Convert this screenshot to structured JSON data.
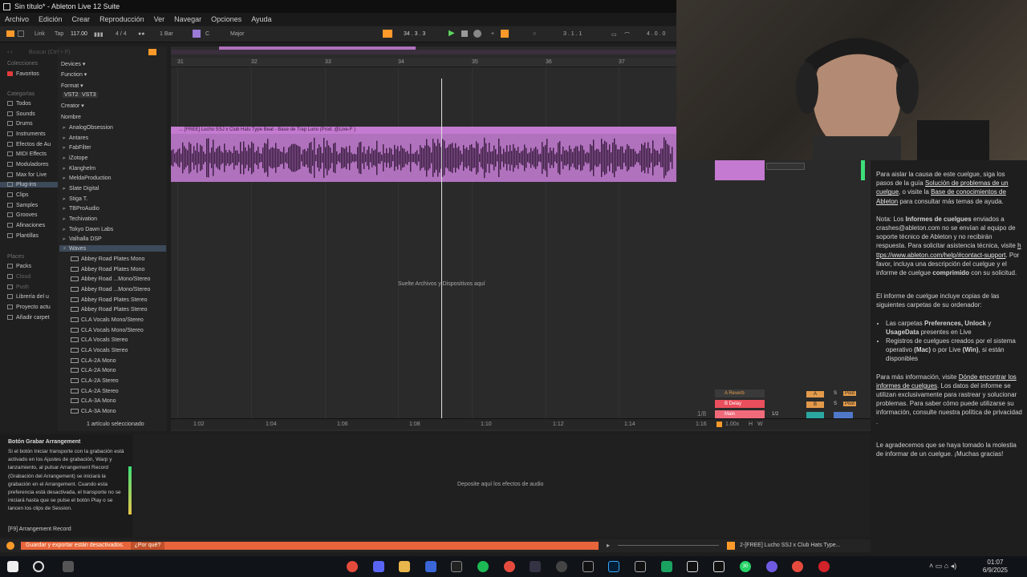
{
  "window": {
    "title": "Sin título* - Ableton Live 12 Suite"
  },
  "menu": [
    "Archivo",
    "Edición",
    "Crear",
    "Reproducción",
    "Ver",
    "Navegar",
    "Opciones",
    "Ayuda"
  ],
  "toolbar": {
    "link": "Link",
    "tap": "Tap",
    "tempo": "117.00",
    "signature": "4 / 4",
    "quantize": "1 Bar",
    "key": "C",
    "scale": "Major",
    "position": "34 .   3 .   3",
    "loop_start": "3 .   1 .   1",
    "loop_len": "4 .   0 .   0"
  },
  "browser": {
    "search_placeholder": "Buscar (Ctrl + F)",
    "collections_head": "Colecciones",
    "favorites": "Favoritos",
    "categories_head": "Categorías",
    "categories": [
      "Todos",
      "Sounds",
      "Drums",
      "Instruments",
      "Efectos de Au",
      "MIDI Effects",
      "Moduladores",
      "Max for Live",
      "Plug-ins",
      "Clips",
      "Samples",
      "Grooves",
      "Afinaciones",
      "Plantillas"
    ],
    "places_head": "Places",
    "places": [
      "Packs",
      "Cloud",
      "Push",
      "Librería del u",
      "Proyecto actu",
      "Añadir carpet"
    ],
    "filters": [
      "Devices ▾",
      "Function ▾",
      "Format ▾",
      "Creator ▾"
    ],
    "formats": [
      "VST2",
      "VST3"
    ],
    "column": "Nombre",
    "vendors": [
      "AnalogObsession",
      "Antares",
      "FabFilter",
      "iZotope",
      "Klanghelm",
      "MeldaProduction",
      "Slate Digital",
      "Stiga T.",
      "TBProAudio",
      "Techivation",
      "Tokyo Dawn Labs",
      "Valhalla DSP",
      "Waves"
    ],
    "plugins": [
      "Abbey Road Plates Mono",
      "Abbey Road Plates Mono",
      "Abbey Road ...Mono/Stereo",
      "Abbey Road ...Mono/Stereo",
      "Abbey Road Plates Stereo",
      "Abbey Road Plates Stereo",
      "CLA Vocals Mono/Stereo",
      "CLA Vocals Mono/Stereo",
      "CLA Vocals Stereo",
      "CLA Vocals Stereo",
      "CLA-2A Mono",
      "CLA-2A Mono",
      "CLA-2A Stereo",
      "CLA-2A Stereo",
      "CLA-3A Mono",
      "CLA-3A Mono"
    ],
    "status": "1 artículo seleccionado"
  },
  "arrangement": {
    "bars": [
      "31",
      "32",
      "33",
      "34",
      "35",
      "36",
      "37"
    ],
    "clip_name": "... [FREE] Lucho SSJ x Club Hats Type Beat - Base de Trap Luno (Prod. @Live-F )",
    "drop_hint": "Suelte Archivos y Dispositivos aquí",
    "times": [
      "1:02",
      "1:04",
      "1:06",
      "1:08",
      "1:10",
      "1:12",
      "1:14",
      "1:16"
    ],
    "tracks": [
      {
        "name": "A Reverb",
        "letter": "A",
        "color": "#e39a4a"
      },
      {
        "name": "B Delay",
        "letter": "B",
        "color": "#e94f5c"
      },
      {
        "name": "Main",
        "letter": "",
        "color": "#f06a7a"
      }
    ],
    "fraction": "1/8",
    "main_div": "1/2",
    "zoom": "1.00x",
    "h_label": "H",
    "w_label": "W",
    "post": "Post",
    "s": "S"
  },
  "info": {
    "title": "Botón Grabar Arrangement",
    "body": "Si el botón Iniciar transporte con la grabación está activado en los Ajustes de grabación, Warp y lanzamiento, al pulsar Arrangement Record (Grabación del Arrangement) se iniciará la grabación en el Arrangement. Cuando esta preferencia está desactivada, el transporte no se iniciará hasta que se pulse el botón Play o se lancen los clips de Session.",
    "shortcut": "[F9] Arrangement Record"
  },
  "devices": {
    "hint": "Deposite aquí los efectos de audio"
  },
  "status": {
    "warning": "Guardar y exportar están desactivados.",
    "why": "¿Por qué?",
    "track_label": "2-[FREE] Lucho SSJ x Club Hats Type..."
  },
  "crash": {
    "p1a": "Para aislar la causa de este cuelgue, siga los pasos de la guía",
    "p1link1": "Solución de problemas de un cuelgue",
    "p1b": ", o visite la",
    "p1link2": "Base de conocimientos de Ableton",
    "p1c": "para consultar más temas de ayuda.",
    "p2a": "Nota: Los",
    "p2b": "Informes de cuelgues",
    "p2c": "enviados a crashes@ableton.com no se envían al equipo de soporte técnico de Ableton y no recibirán respuesta. Para solicitar asistencia técnica, visite",
    "p2link": "https://www.ableton.com/help/#contact-support",
    "p2d": ". Por favor, incluya una descripción del cuelgue y el informe de cuelgue",
    "p2e": "comprimido",
    "p2f": "con su solicitud.",
    "p3": "El informe de cuelgue incluye copias de las siguientes carpetas de su ordenador:",
    "li1a": "Las carpetas",
    "li1b": "Preferences, Unlock",
    "li1c": "y",
    "li1d": "UsageData",
    "li1e": "presentes en Live",
    "li2a": "Registros de cuelgues creados por el sistema operativo",
    "li2b": "(Mac)",
    "li2c": "o por Live",
    "li2d": "(Win)",
    "li2e": ", si están disponibles",
    "p4a": "Para más información, visite",
    "p4link": "Dónde encontrar los informes de cuelgues",
    "p4b": ". Los datos del informe se utilizan exclusivamente para rastrear y solucionar problemas. Para saber cómo puede utilizarse su información, consulte nuestra política de privacidad .",
    "p5": "Le agradecemos que se haya tomado la molestia de informar de un cuelgue. ¡Muchas gracias!"
  },
  "taskbar": {
    "time": "01:07",
    "date": "6/9/2025",
    "badge": "30"
  },
  "colors": {
    "accent": "#ff9a2a",
    "clip": "#b071bd",
    "warning": "#e8643b"
  }
}
